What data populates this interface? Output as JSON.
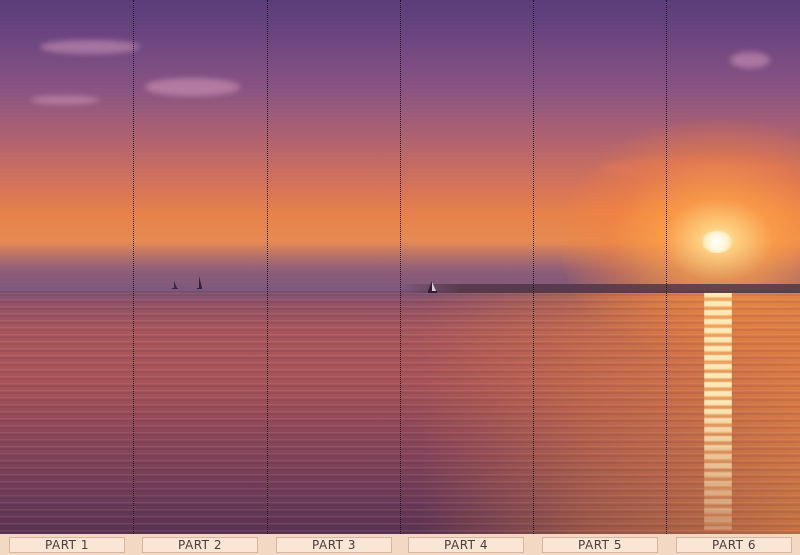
{
  "image": {
    "subject": "sunset-over-lake",
    "accent_colors": [
      "#5a3d78",
      "#e7824a",
      "#fff6d8",
      "#a85459"
    ]
  },
  "parts": [
    {
      "label": "PART 1"
    },
    {
      "label": "PART 2"
    },
    {
      "label": "PART 3"
    },
    {
      "label": "PART 4"
    },
    {
      "label": "PART 5"
    },
    {
      "label": "PART 6"
    }
  ]
}
